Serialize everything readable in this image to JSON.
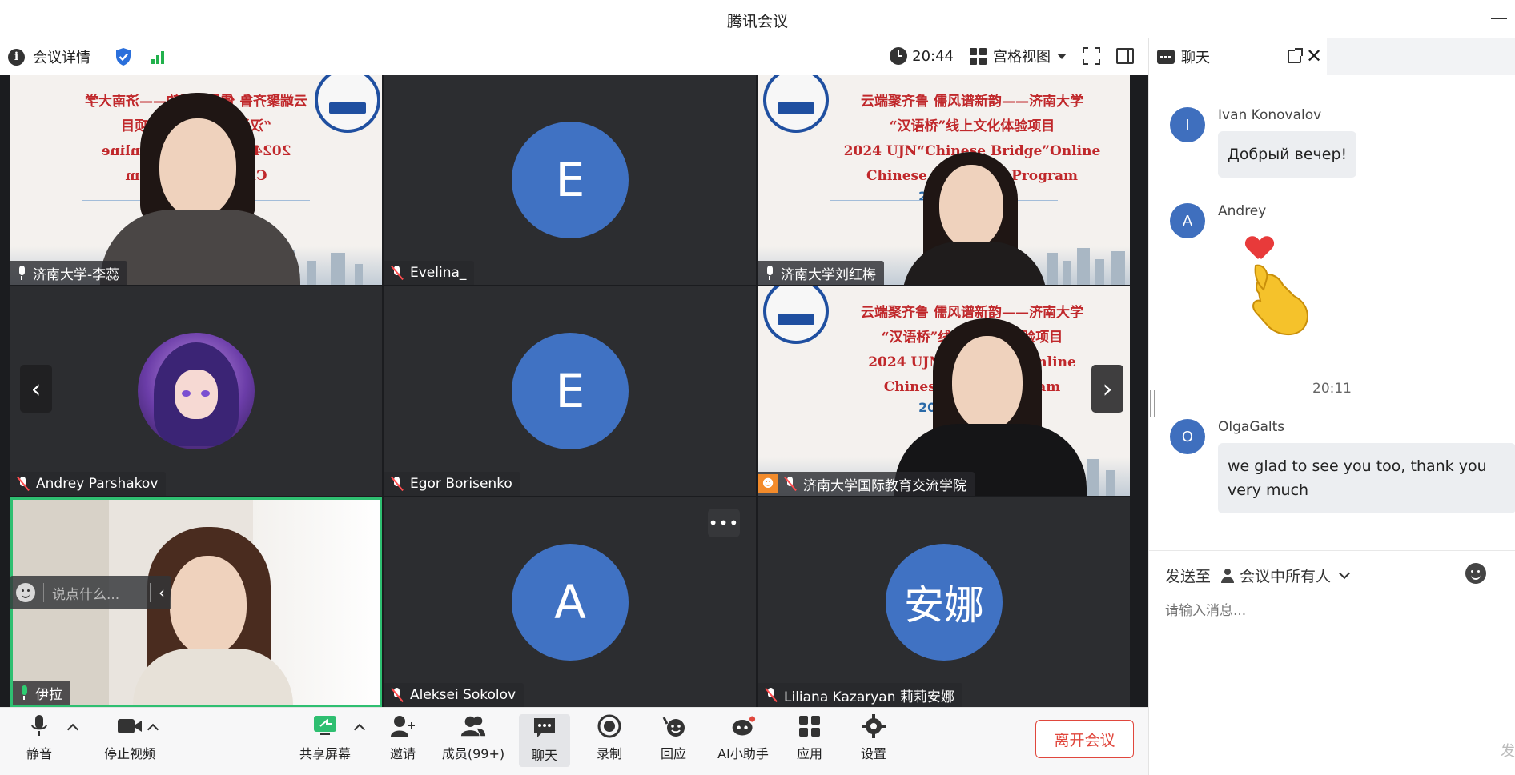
{
  "app": {
    "title": "腾讯会议"
  },
  "infobar": {
    "meeting_details": "会议详情",
    "time": "20:44",
    "view_mode": "宫格视图"
  },
  "tiles": [
    {
      "name": "济南大学-李蕊",
      "mic": "on"
    },
    {
      "name": "Evelina_",
      "mic": "off",
      "avatar": "E"
    },
    {
      "name": "济南大学刘红梅",
      "mic": "on"
    },
    {
      "name": "Andrey Parshakov",
      "mic": "off"
    },
    {
      "name": "Egor Borisenko",
      "mic": "off",
      "avatar": "E"
    },
    {
      "name": "济南大学国际教育交流学院",
      "mic": "off",
      "host": true
    },
    {
      "name": "伊拉",
      "mic": "speaking"
    },
    {
      "name": "Aleksei Sokolov",
      "mic": "off",
      "avatar": "A"
    },
    {
      "name": "Liliana Kazaryan 莉莉安娜",
      "mic": "off",
      "avatar": "安娜"
    }
  ],
  "banner": {
    "line1": "云端聚齐鲁 儒风谱新韵——济南大学",
    "line2": "“汉语桥”线上文化体验项目",
    "line3": "2024 UJN“Chinese Bridge”Online",
    "line4": "Chinese Language Program",
    "year_fragment": "20",
    "partial_line1": "云端聚齐鲁 儒风谱新韵——济南大学",
    "partial_line2": "“汉语桥”线",
    "partial_line2b": "体验项目",
    "partial_line3": "2024 UJN“Ch",
    "partial_line3b": "”Online",
    "partial_line4": "Chinese L",
    "partial_line4b": "ram",
    "mirror_line1": "云端聚齐鲁 儒风谱新韵——济南大学",
    "mirror_line2": "“汉语桥",
    "mirror_line2b": "体验项目",
    "mirror_line3": "2024 UJ",
    "mirror_line3b": "ge”Online",
    "mirror_line4": "Chin",
    "mirror_line4b": "ogram"
  },
  "quick_chat": {
    "placeholder": "说点什么..."
  },
  "toolbar": {
    "mute": "静音",
    "stop_video": "停止视频",
    "share_screen": "共享屏幕",
    "invite": "邀请",
    "members": "成员(99+)",
    "chat": "聊天",
    "record": "录制",
    "react": "回应",
    "ai_assistant": "AI小助手",
    "apps": "应用",
    "settings": "设置",
    "leave": "离开会议"
  },
  "chat": {
    "title": "聊天",
    "messages": [
      {
        "avatar": "I",
        "sender": "Ivan Konovalov",
        "text": "Добрый вечер!"
      },
      {
        "avatar": "A",
        "sender": "Andrey",
        "emoji": "heart-finger"
      },
      {
        "avatar": "O",
        "sender": "OlgaGalts",
        "text": "we glad to see you too, thank you very much"
      }
    ],
    "time_divider": "20:11",
    "send_to_label": "发送至",
    "send_to_target": "会议中所有人",
    "input_placeholder": "请输入消息...",
    "send_button": "发"
  },
  "colors": {
    "avatar_blue": "#4072c3",
    "leave_red": "#e0473d",
    "active_border": "#2fbf71",
    "banner_red": "#c0282b"
  }
}
